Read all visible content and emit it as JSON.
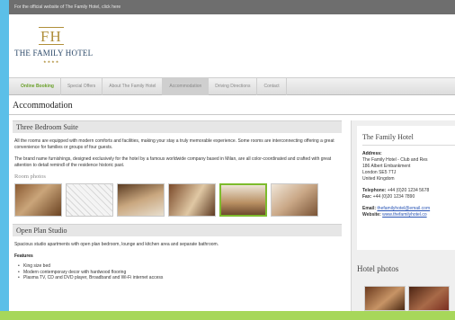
{
  "notice": "For the official website of The Family Hotel, click here",
  "logo": {
    "mark": "FH",
    "name": "THE FAMILY HOTEL",
    "stars": "★★★★"
  },
  "nav": [
    "Online Booking",
    "Special Offers",
    "About The Family Hotel",
    "Accommodation",
    "Driving Directions",
    "Contact"
  ],
  "page_title": "Accommodation",
  "suite": {
    "heading": "Three Bedroom Suite",
    "para1": "All the rooms are equipped with modern comforts and facilities, making your stay a truly memorable experience. Some rooms are interconnecting offering a great convenience for families or groups of four guests.",
    "para2": "The brand name furnishings, designed exclusively for the hotel by a famous worldwide company based in Milan, are all color-coordinated and crafted with great attention to detail remindl of the residence historic past.",
    "photos_label": "Room photos"
  },
  "studio": {
    "heading": "Open Plan Studio",
    "para": "Spacious studio apartments with open plan bedroom, lounge and kitchen area and separate bathroom.",
    "features_label": "Features",
    "features": [
      "King size bed",
      "Modern contemporary decor with hardwood flooring",
      "Plasma TV, CD and DVD player, Broadband and Wi-Fi internet access"
    ]
  },
  "sidebar": {
    "title": "The Family Hotel",
    "address_label": "Address:",
    "address": [
      "The Family Hotel - Club and Res",
      "186 Albert Embankment",
      "London SE5 7TJ",
      "United Kingdom"
    ],
    "telephone_label": "Telephone:",
    "telephone": "+44 (0)20 1234 5678",
    "fax_label": "Fax:",
    "fax": "+44 (0)20 1234 7890",
    "email_label": "Email:",
    "email": "thefamilyhotel@email.com",
    "website_label": "Website:",
    "website": "www.thefamilyhotel.co",
    "photos_title": "Hotel photos"
  }
}
